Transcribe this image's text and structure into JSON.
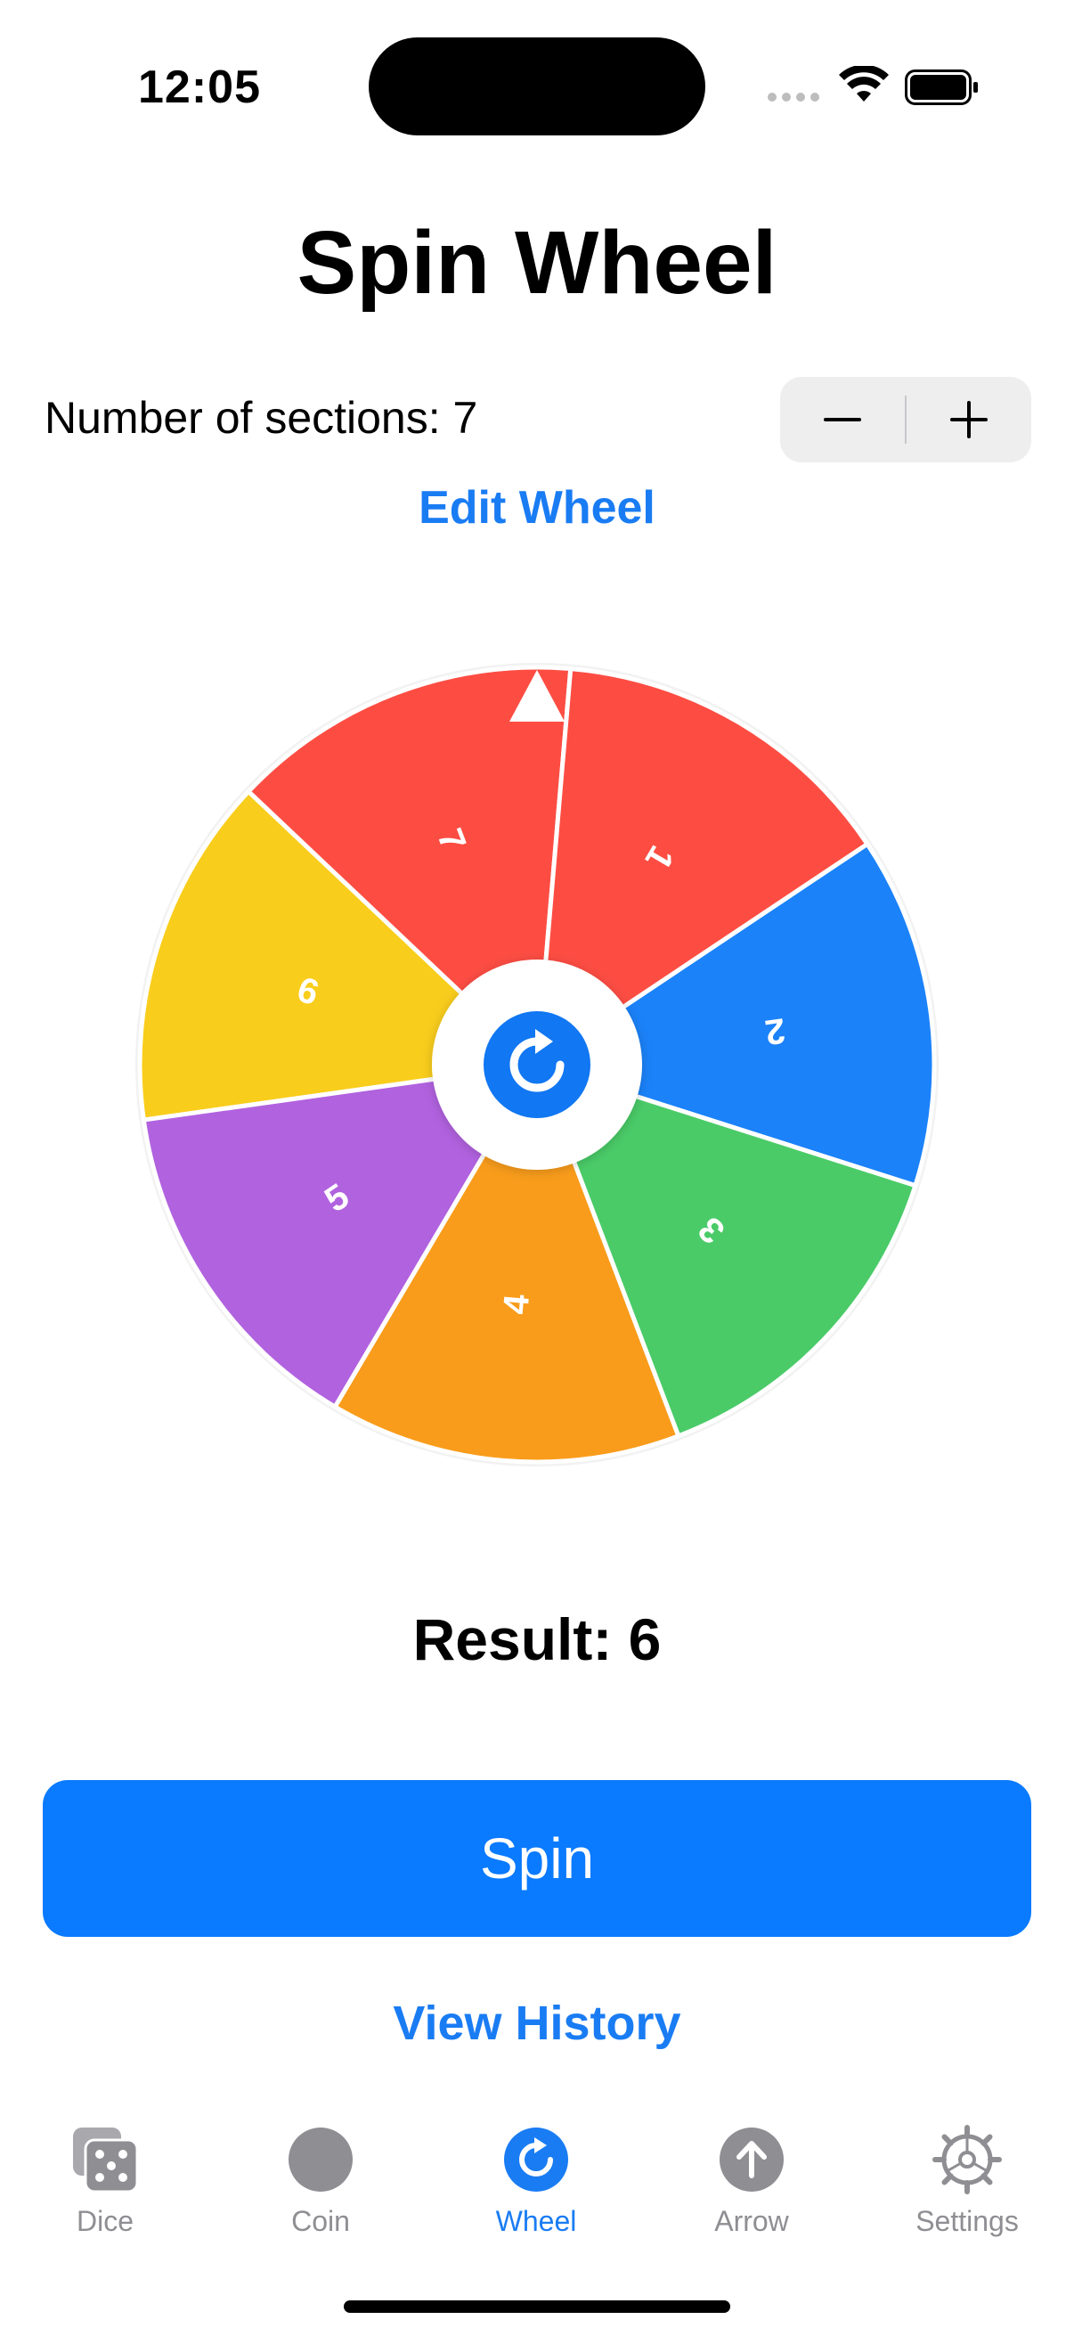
{
  "status_bar": {
    "time": "12:05"
  },
  "header": {
    "title": "Spin Wheel"
  },
  "sections": {
    "label": "Number of sections: 7",
    "decrement": "−",
    "increment": "+"
  },
  "edit_link": "Edit Wheel",
  "wheel": {
    "segments": [
      {
        "label": "6",
        "color": "#f9cd1c"
      },
      {
        "label": "7",
        "color": "#fd4d43"
      },
      {
        "label": "1",
        "color": "#fd4d43"
      },
      {
        "label": "2",
        "color": "#1b82f9"
      },
      {
        "label": "3",
        "color": "#4acb68"
      },
      {
        "label": "4",
        "color": "#f99c1b"
      },
      {
        "label": "5",
        "color": "#b162df"
      }
    ],
    "pointer": "triangle-pointer",
    "center_icon": "rotate-icon"
  },
  "result": "Result: 6",
  "spin_button": "Spin",
  "history_link": "View History",
  "tabs": [
    {
      "label": "Dice",
      "icon": "dice-icon",
      "active": false
    },
    {
      "label": "Coin",
      "icon": "coin-icon",
      "active": false
    },
    {
      "label": "Wheel",
      "icon": "wheel-icon",
      "active": true
    },
    {
      "label": "Arrow",
      "icon": "arrow-up-icon",
      "active": false
    },
    {
      "label": "Settings",
      "icon": "gear-icon",
      "active": false
    }
  ],
  "colors": {
    "accent": "#1a7cf3",
    "inactive": "#8e8e93"
  }
}
